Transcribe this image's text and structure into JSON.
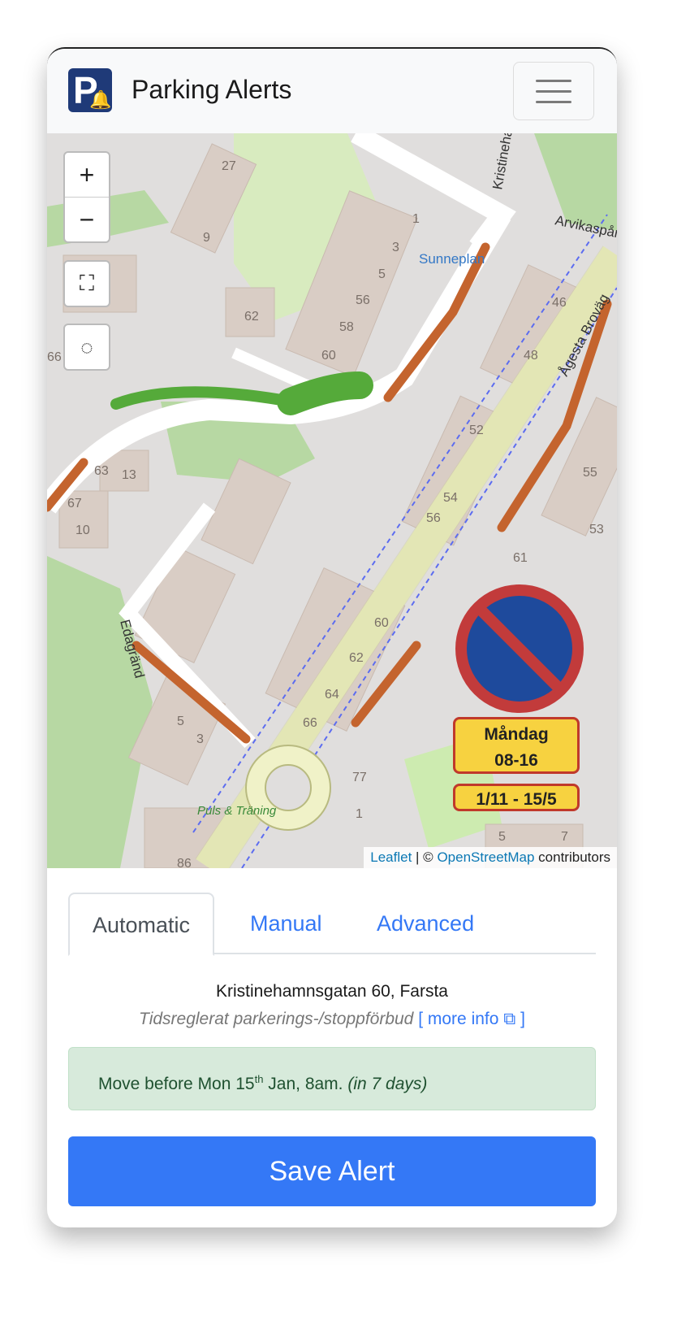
{
  "navbar": {
    "title": "Parking Alerts",
    "logo_letter": "P",
    "menu_icon": "hamburger-icon"
  },
  "map": {
    "zoom_in": "+",
    "zoom_out": "−",
    "street_labels": [
      "Kristinehamnsgatan",
      "Arvikaspår",
      "Ågesta Broväg",
      "Edagränd",
      "Sunneplan",
      "Puls & Träning"
    ],
    "house_numbers": [
      "27",
      "9",
      "1",
      "3",
      "5",
      "56",
      "58",
      "60",
      "62",
      "64",
      "66",
      "46",
      "48",
      "52",
      "54",
      "56",
      "55",
      "53",
      "63",
      "13",
      "67",
      "10",
      "61",
      "60",
      "62",
      "64",
      "66",
      "5",
      "3",
      "77",
      "1",
      "86",
      "5",
      "7"
    ],
    "sign": {
      "day": "Måndag",
      "hours": "08-16",
      "period": "1/11 - 15/5"
    },
    "attribution": {
      "leaflet": "Leaflet",
      "separator": " | © ",
      "osm": "OpenStreetMap",
      "suffix": " contributors"
    },
    "colors": {
      "restriction": "#c4642e",
      "current": "#55aa3a"
    }
  },
  "tabs": [
    {
      "label": "Automatic",
      "active": true
    },
    {
      "label": "Manual"
    },
    {
      "label": "Advanced"
    }
  ],
  "location": {
    "address": "Kristinehamnsgatan 60, Farsta",
    "regulation": "Tidsreglerat parkerings-/stoppförbud",
    "more_info": "[ more info ⧉ ]"
  },
  "alert": {
    "prefix": "Move before Mon 15",
    "sup": "th",
    "suffix": " Jan, 8am. ",
    "relative": "(in 7 days)"
  },
  "save_button": "Save Alert"
}
